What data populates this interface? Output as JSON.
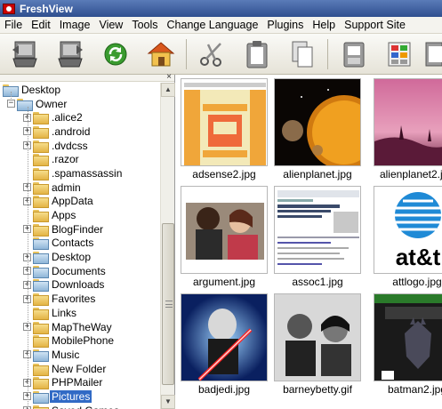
{
  "window": {
    "title": "FreshView"
  },
  "menu": [
    "File",
    "Edit",
    "Image",
    "View",
    "Tools",
    "Change Language",
    "Plugins",
    "Help",
    "Support Site"
  ],
  "toolbar": {
    "buttons": [
      "monitor-back-icon",
      "monitor-forward-icon",
      "refresh-icon",
      "home-icon",
      "scissors-icon",
      "clipboard-icon",
      "copy-icon",
      "slideshow-icon",
      "thumbnails-icon",
      "more-icon"
    ]
  },
  "pane": {
    "close_glyph": "×"
  },
  "tree": [
    {
      "label": "Desktop",
      "level": 0,
      "icon": "desktop"
    },
    {
      "label": "Owner",
      "level": 1,
      "icon": "user-folder",
      "expander": "−"
    },
    {
      "label": ".alice2",
      "level": 2,
      "expander": "+"
    },
    {
      "label": ".android",
      "level": 2,
      "expander": "+"
    },
    {
      "label": ".dvdcss",
      "level": 2,
      "expander": "+"
    },
    {
      "label": ".razor",
      "level": 2
    },
    {
      "label": ".spamassassin",
      "level": 2
    },
    {
      "label": "admin",
      "level": 2,
      "expander": "+"
    },
    {
      "label": "AppData",
      "level": 2,
      "expander": "+"
    },
    {
      "label": "Apps",
      "level": 2
    },
    {
      "label": "BlogFinder",
      "level": 2,
      "expander": "+"
    },
    {
      "label": "Contacts",
      "level": 2,
      "special": true
    },
    {
      "label": "Desktop",
      "level": 2,
      "expander": "+",
      "special": true
    },
    {
      "label": "Documents",
      "level": 2,
      "expander": "+",
      "special": true
    },
    {
      "label": "Downloads",
      "level": 2,
      "expander": "+",
      "special": true
    },
    {
      "label": "Favorites",
      "level": 2,
      "expander": "+"
    },
    {
      "label": "Links",
      "level": 2
    },
    {
      "label": "MapTheWay",
      "level": 2,
      "expander": "+"
    },
    {
      "label": "MobilePhone",
      "level": 2
    },
    {
      "label": "Music",
      "level": 2,
      "expander": "+",
      "special": true
    },
    {
      "label": "New Folder",
      "level": 2
    },
    {
      "label": "PHPMailer",
      "level": 2,
      "expander": "+"
    },
    {
      "label": "Pictures",
      "level": 2,
      "expander": "+",
      "special": true,
      "selected": true
    },
    {
      "label": "Saved Games",
      "level": 2,
      "expander": "+"
    }
  ],
  "thumbnails": [
    {
      "name": "adsense2.jpg",
      "kind": "adsense"
    },
    {
      "name": "alienplanet.jpg",
      "kind": "alienplanet"
    },
    {
      "name": "alienplanet2.jpg",
      "kind": "alienplanet2"
    },
    {
      "name": "argument.jpg",
      "kind": "argument"
    },
    {
      "name": "assoc1.jpg",
      "kind": "assoc"
    },
    {
      "name": "attlogo.jpg",
      "kind": "att",
      "logo_text": "at&t"
    },
    {
      "name": "badjedi.jpg",
      "kind": "badjedi"
    },
    {
      "name": "barneybetty.gif",
      "kind": "barney"
    },
    {
      "name": "batman2.jpg",
      "kind": "batman"
    }
  ]
}
